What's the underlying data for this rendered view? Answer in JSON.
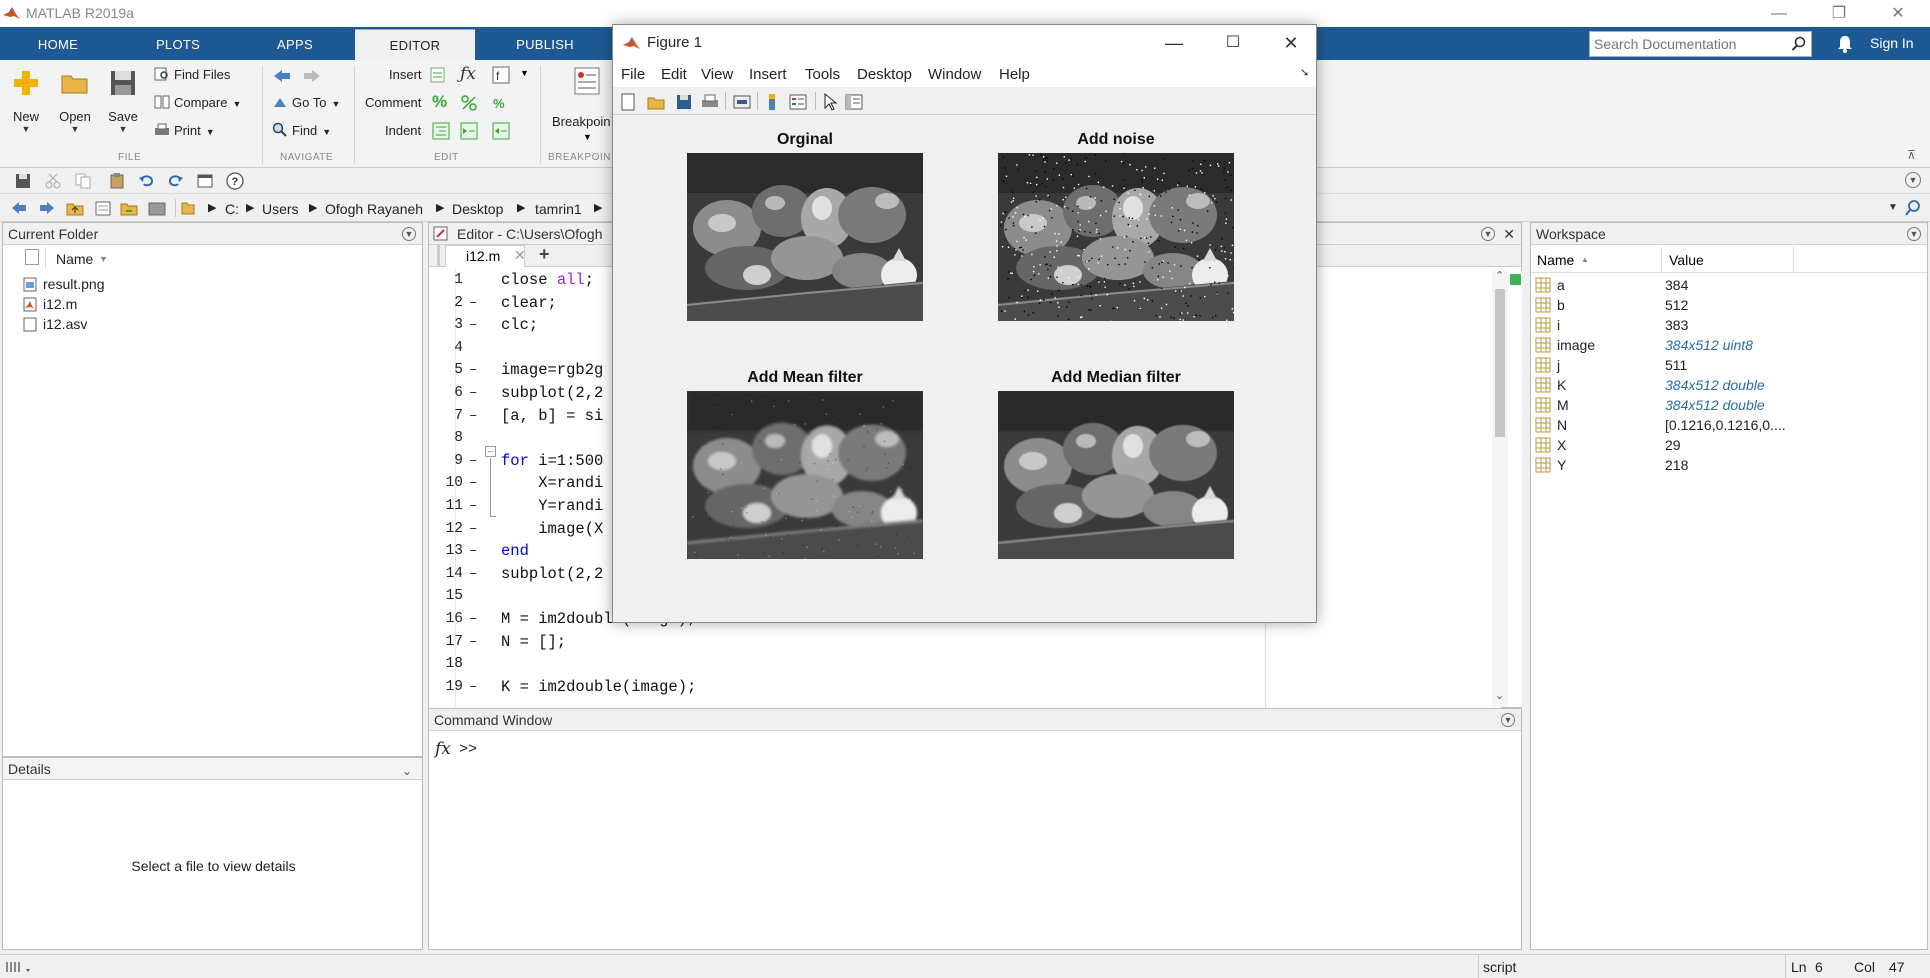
{
  "app": {
    "title": "MATLAB R2019a"
  },
  "window_controls": {
    "minimize": "—",
    "restore": "❐",
    "close": "✕"
  },
  "tabs": [
    {
      "label": "HOME"
    },
    {
      "label": "PLOTS"
    },
    {
      "label": "APPS"
    },
    {
      "label": "EDITOR"
    },
    {
      "label": "PUBLISH"
    }
  ],
  "search": {
    "placeholder": "Search Documentation"
  },
  "signin": "Sign In",
  "ribbon": {
    "file": {
      "new": "New",
      "open": "Open",
      "save": "Save",
      "find_files": "Find Files",
      "compare": "Compare",
      "print": "Print",
      "group": "FILE"
    },
    "navigate": {
      "go_to": "Go To",
      "find": "Find",
      "group": "NAVIGATE"
    },
    "edit": {
      "insert": "Insert",
      "comment": "Comment",
      "indent": "Indent",
      "group": "EDIT"
    },
    "breakpoints": {
      "label": "Breakpoin",
      "group": "BREAKPOIN"
    }
  },
  "address": {
    "path": [
      "C:",
      "Users",
      "Ofogh Rayaneh",
      "Desktop",
      "tamrin1"
    ]
  },
  "current_folder": {
    "title": "Current Folder",
    "column": "Name",
    "files": [
      {
        "name": "result.png",
        "icon": "image-file-icon"
      },
      {
        "name": "i12.m",
        "icon": "m-file-icon"
      },
      {
        "name": "i12.asv",
        "icon": "file-icon"
      }
    ]
  },
  "details": {
    "title": "Details",
    "empty": "Select a file to view details"
  },
  "editor": {
    "title": "Editor - C:\\Users\\Ofogh",
    "tab": "i12.m",
    "lines": [
      {
        "n": "1",
        "d": "",
        "code": "close all;"
      },
      {
        "n": "2",
        "d": "–",
        "code": "clear;"
      },
      {
        "n": "3",
        "d": "–",
        "code": "clc;"
      },
      {
        "n": "4",
        "d": "",
        "code": ""
      },
      {
        "n": "5",
        "d": "–",
        "code": "image=rgb2g"
      },
      {
        "n": "6",
        "d": "–",
        "code": "subplot(2,2"
      },
      {
        "n": "7",
        "d": "–",
        "code": "[a, b] = si"
      },
      {
        "n": "8",
        "d": "",
        "code": ""
      },
      {
        "n": "9",
        "d": "–",
        "code": "for i=1:500"
      },
      {
        "n": "10",
        "d": "–",
        "code": "    X=randi"
      },
      {
        "n": "11",
        "d": "–",
        "code": "    Y=randi"
      },
      {
        "n": "12",
        "d": "–",
        "code": "    image(X"
      },
      {
        "n": "13",
        "d": "–",
        "code": "end"
      },
      {
        "n": "14",
        "d": "–",
        "code": "subplot(2,2"
      },
      {
        "n": "15",
        "d": "",
        "code": ""
      },
      {
        "n": "16",
        "d": "–",
        "code": "M = im2double(image);"
      },
      {
        "n": "17",
        "d": "–",
        "code": "N = [];"
      },
      {
        "n": "18",
        "d": "",
        "code": ""
      },
      {
        "n": "19",
        "d": "–",
        "code": "K = im2double(image);"
      }
    ]
  },
  "command_window": {
    "title": "Command Window",
    "fx": "fx",
    "prompt": ">>"
  },
  "workspace": {
    "title": "Workspace",
    "columns": {
      "name": "Name",
      "value": "Value"
    },
    "vars": [
      {
        "name": "a",
        "value": "384",
        "italic": false
      },
      {
        "name": "b",
        "value": "512",
        "italic": false
      },
      {
        "name": "i",
        "value": "383",
        "italic": false
      },
      {
        "name": "image",
        "value": "384x512 uint8",
        "italic": true
      },
      {
        "name": "j",
        "value": "511",
        "italic": false
      },
      {
        "name": "K",
        "value": "384x512 double",
        "italic": true
      },
      {
        "name": "M",
        "value": "384x512 double",
        "italic": true
      },
      {
        "name": "N",
        "value": "[0.1216,0.1216,0....",
        "italic": false
      },
      {
        "name": "X",
        "value": "29",
        "italic": false
      },
      {
        "name": "Y",
        "value": "218",
        "italic": false
      }
    ]
  },
  "figure": {
    "title": "Figure 1",
    "menu": [
      "File",
      "Edit",
      "View",
      "Insert",
      "Tools",
      "Desktop",
      "Window",
      "Help"
    ],
    "subplots": [
      {
        "title": "Orginal",
        "variant": "orig"
      },
      {
        "title": "Add noise",
        "variant": "noise"
      },
      {
        "title": "Add Mean filter",
        "variant": "mean"
      },
      {
        "title": "Add Median filter",
        "variant": "median"
      }
    ]
  },
  "status": {
    "mode": "script",
    "ln_label": "Ln",
    "ln": "6",
    "col_label": "Col",
    "col": "47"
  },
  "colors": {
    "tabbar": "#1d5a95",
    "keyword": "#0000ff",
    "string": "#a020f0",
    "italic_value": "#2a6ab5"
  }
}
